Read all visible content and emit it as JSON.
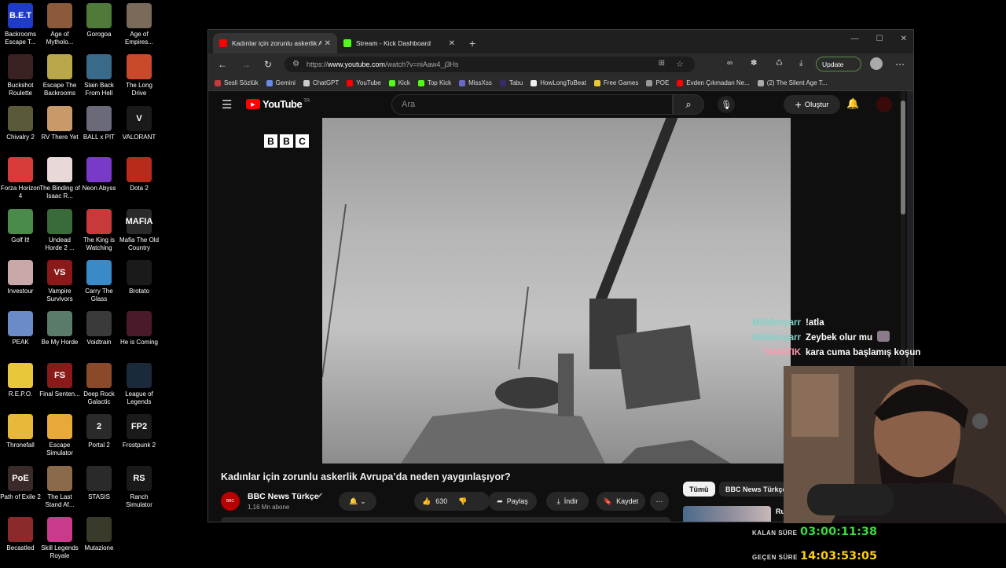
{
  "desktop": {
    "icons": [
      {
        "label": "Backrooms Escape T...",
        "icon": "bet-logo-icon",
        "color": "#1e3cc8",
        "glyph": "B.E.T"
      },
      {
        "label": "Age of Mytholo...",
        "icon": "age-of-mythology-icon",
        "color": "#8a5a3a",
        "glyph": ""
      },
      {
        "label": "Gorogoa",
        "icon": "gorogoa-icon",
        "color": "#4f7a3a",
        "glyph": ""
      },
      {
        "label": "Age of Empires...",
        "icon": "age-of-empires-icon",
        "color": "#7a6a5a",
        "glyph": ""
      },
      {
        "label": "Buckshot Roulette",
        "icon": "buckshot-roulette-icon",
        "color": "#3a2222",
        "glyph": ""
      },
      {
        "label": "Escape The Backrooms",
        "icon": "escape-backrooms-icon",
        "color": "#b8a84a",
        "glyph": ""
      },
      {
        "label": "Slain Back From Hell",
        "icon": "slain-icon",
        "color": "#3a6a8a",
        "glyph": ""
      },
      {
        "label": "The Long Drive",
        "icon": "long-drive-icon",
        "color": "#c84a2a",
        "glyph": ""
      },
      {
        "label": "Chivalry 2",
        "icon": "chivalry-icon",
        "color": "#5a5a3a",
        "glyph": ""
      },
      {
        "label": "RV There Yet",
        "icon": "rv-there-yet-icon",
        "color": "#c89a6a",
        "glyph": ""
      },
      {
        "label": "BALL x PIT",
        "icon": "ball-x-pit-icon",
        "color": "#6a6a7a",
        "glyph": ""
      },
      {
        "label": "VALORANT",
        "icon": "valorant-icon",
        "color": "#1a1a1a",
        "glyph": "V"
      },
      {
        "label": "Forza Horizon 4",
        "icon": "forza-icon",
        "color": "#d83a3a",
        "glyph": ""
      },
      {
        "label": "The Binding of Isaac R...",
        "icon": "isaac-icon",
        "color": "#e8d8d8",
        "glyph": ""
      },
      {
        "label": "Neon Abyss",
        "icon": "neon-abyss-icon",
        "color": "#7a3ac8",
        "glyph": ""
      },
      {
        "label": "Dota 2",
        "icon": "dota-icon",
        "color": "#b82a1a",
        "glyph": ""
      },
      {
        "label": "Golf It!",
        "icon": "golf-it-icon",
        "color": "#4a8a4a",
        "glyph": ""
      },
      {
        "label": "Undead Horde 2 ...",
        "icon": "undead-horde-icon",
        "color": "#3a6a3a",
        "glyph": ""
      },
      {
        "label": "The King is Watching",
        "icon": "king-watching-icon",
        "color": "#c83a3a",
        "glyph": ""
      },
      {
        "label": "Mafia The Old Country",
        "icon": "mafia-icon",
        "color": "#2a2a2a",
        "glyph": "MAFIA"
      },
      {
        "label": "Investour",
        "icon": "investour-icon",
        "color": "#c8a8a8",
        "glyph": ""
      },
      {
        "label": "Vampire Survivors",
        "icon": "vampire-survivors-icon",
        "color": "#8a1a1a",
        "glyph": "VS"
      },
      {
        "label": "Carry The Glass",
        "icon": "carry-glass-icon",
        "color": "#3a8ac8",
        "glyph": ""
      },
      {
        "label": "Brotato",
        "icon": "brotato-icon",
        "color": "#1a1a1a",
        "glyph": ""
      },
      {
        "label": "PEAK",
        "icon": "peak-icon",
        "color": "#6a8ac8",
        "glyph": ""
      },
      {
        "label": "Be My Horde",
        "icon": "be-my-horde-icon",
        "color": "#5a7a6a",
        "glyph": ""
      },
      {
        "label": "Voidtrain",
        "icon": "voidtrain-icon",
        "color": "#3a3a3a",
        "glyph": ""
      },
      {
        "label": "He is Coming",
        "icon": "he-is-coming-icon",
        "color": "#4a1a2a",
        "glyph": ""
      },
      {
        "label": "R.E.P.O.",
        "icon": "repo-icon",
        "color": "#e8c83a",
        "glyph": ""
      },
      {
        "label": "Final Senten...",
        "icon": "final-sentence-icon",
        "color": "#8a1a1a",
        "glyph": "FS"
      },
      {
        "label": "Deep Rock Galactic",
        "icon": "deep-rock-icon",
        "color": "#8a4a2a",
        "glyph": ""
      },
      {
        "label": "League of Legends",
        "icon": "league-icon",
        "color": "#1a2a3a",
        "glyph": ""
      },
      {
        "label": "Thronefall",
        "icon": "thronefall-icon",
        "color": "#e8b83a",
        "glyph": ""
      },
      {
        "label": "Escape Simulator",
        "icon": "escape-simulator-icon",
        "color": "#e8a83a",
        "glyph": ""
      },
      {
        "label": "Portal 2",
        "icon": "portal-icon",
        "color": "#2a2a2a",
        "glyph": "2"
      },
      {
        "label": "Frostpunk 2",
        "icon": "frostpunk-icon",
        "color": "#1a1a1a",
        "glyph": "FP2"
      },
      {
        "label": "Path of Exile 2",
        "icon": "path-of-exile-icon",
        "color": "#3a2a2a",
        "glyph": "PoE"
      },
      {
        "label": "The Last Stand Af...",
        "icon": "last-stand-icon",
        "color": "#8a6a4a",
        "glyph": ""
      },
      {
        "label": "STASIS",
        "icon": "stasis-icon",
        "color": "#2a2a2a",
        "glyph": ""
      },
      {
        "label": "Ranch Simulator",
        "icon": "ranch-simulator-icon",
        "color": "#1a1a1a",
        "glyph": "RS"
      },
      {
        "label": "Becastled",
        "icon": "becastled-icon",
        "color": "#8a2a2a",
        "glyph": ""
      },
      {
        "label": "Skill Legends Royale",
        "icon": "skill-legends-icon",
        "color": "#c83a8a",
        "glyph": ""
      },
      {
        "label": "Mutazione",
        "icon": "mutazione-icon",
        "color": "#3a3a2a",
        "glyph": ""
      }
    ]
  },
  "browser": {
    "tabs": [
      {
        "title": "Kadınlar için zorunlu askerlik Avru",
        "favicon_color": "#ff0000",
        "active": true
      },
      {
        "title": "Stream - Kick Dashboard",
        "favicon_color": "#53fc18",
        "active": false
      }
    ],
    "new_tab": "+",
    "url_prefix": "https://",
    "url_host": "www.youtube.com",
    "url_path": "/watch?v=niAaw4_j3Hs",
    "update_label": "Update",
    "bookmarks": [
      {
        "label": "Sesli Sözlük",
        "color": "#c83a3a"
      },
      {
        "label": "Gemini",
        "color": "#6a8ae8"
      },
      {
        "label": "ChatGPT",
        "color": "#cccccc"
      },
      {
        "label": "YouTube",
        "color": "#ff0000"
      },
      {
        "label": "Kick",
        "color": "#53fc18"
      },
      {
        "label": "Top Kick",
        "color": "#53fc18"
      },
      {
        "label": "MissXss",
        "color": "#6a6ac8"
      },
      {
        "label": "Tabu",
        "color": "#3a2a6a"
      },
      {
        "label": "HowLongToBeat",
        "color": "#eeeeee"
      },
      {
        "label": "Free Games",
        "color": "#e8c83a"
      },
      {
        "label": "POE",
        "color": "#999999"
      },
      {
        "label": "Evden Çıkmadan Ne...",
        "color": "#ff0000"
      },
      {
        "label": "(2) The Silent Age T...",
        "color": "#aaaaaa"
      }
    ]
  },
  "youtube": {
    "logo_text": "YouTube",
    "region": "TR",
    "search_placeholder": "Ara",
    "create_label": "Oluştur",
    "bbc_letters": [
      "B",
      "B",
      "C"
    ],
    "video_title": "Kadınlar için zorunlu askerlik Avrupa’da neden yaygınlaşıyor?",
    "channel_name": "BBC News Türkçe",
    "subscribers": "1,16 Mn abone",
    "likes": "630",
    "share_label": "Paylaş",
    "download_label": "İndir",
    "save_label": "Kaydet",
    "chips": [
      "Tümü",
      "BBC News Türkçe"
    ],
    "rec_partial": "Ru"
  },
  "chat": [
    {
      "user": "Middenyarr",
      "message": "!atla",
      "color": "#7ed3c8"
    },
    {
      "user": "Middenyarr",
      "message": "Zeybek olur mu",
      "color": "#7ed3c8"
    },
    {
      "user": "YARATIK",
      "message": "kara cuma başlamış koşun",
      "color": "#ff9ab0"
    }
  ],
  "timers": [
    {
      "label": "KALAN SÜRE",
      "value": "03:00:11:38",
      "color": "#3ad83a"
    },
    {
      "label": "GEÇEN SÜRE",
      "value": "14:03:53:05",
      "color": "#ffcc1a"
    }
  ]
}
